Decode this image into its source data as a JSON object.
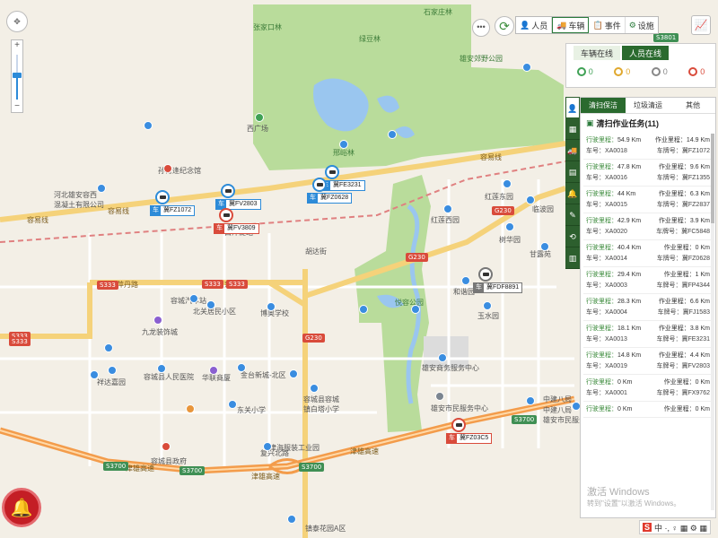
{
  "map": {
    "labels": [
      {
        "text": "张家口林",
        "cls": "green"
      },
      {
        "text": "石家庄林",
        "cls": "green"
      },
      {
        "text": "绿豆林",
        "cls": "green"
      },
      {
        "text": "雄安郊野公园",
        "cls": "green"
      },
      {
        "text": "西广场",
        "cls": ""
      },
      {
        "text": "邢峪林",
        "cls": "green"
      },
      {
        "text": "孙奇逢纪念馆",
        "cls": ""
      },
      {
        "text": "河北雄安容西\n混凝土有限公司",
        "cls": ""
      },
      {
        "text": "白洋淀站",
        "cls": ""
      },
      {
        "text": "红莲东园",
        "cls": ""
      },
      {
        "text": "红莲西园",
        "cls": ""
      },
      {
        "text": "临波园",
        "cls": ""
      },
      {
        "text": "树华园",
        "cls": ""
      },
      {
        "text": "甘露苑",
        "cls": ""
      },
      {
        "text": "和谐园",
        "cls": ""
      },
      {
        "text": "玉水园",
        "cls": ""
      },
      {
        "text": "容城汽车站",
        "cls": ""
      },
      {
        "text": "北关居民小区",
        "cls": ""
      },
      {
        "text": "博奥学校",
        "cls": ""
      },
      {
        "text": "九龙装饰城",
        "cls": ""
      },
      {
        "text": "容城县人民医院",
        "cls": ""
      },
      {
        "text": "华联商厦",
        "cls": ""
      },
      {
        "text": "金台新城-北区",
        "cls": ""
      },
      {
        "text": "祥达嘉园",
        "cls": ""
      },
      {
        "text": "东关小学",
        "cls": ""
      },
      {
        "text": "容城县容城\n镇白塔小学",
        "cls": ""
      },
      {
        "text": "雄安商务服务中心",
        "cls": ""
      },
      {
        "text": "雄安市民服务中心",
        "cls": ""
      },
      {
        "text": "津海服装工业园",
        "cls": ""
      },
      {
        "text": "容城县政府",
        "cls": ""
      },
      {
        "text": "镇泰花园A区",
        "cls": ""
      },
      {
        "text": "中建八局",
        "cls": ""
      },
      {
        "text": "中建八局\n雄安市民服务中心",
        "cls": ""
      },
      {
        "text": "悦容公园",
        "cls": "green"
      },
      {
        "text": "胡达街",
        "cls": ""
      },
      {
        "text": "复兴北路",
        "cls": ""
      }
    ],
    "roads": [
      "容易线",
      "容易线",
      "容易线",
      "萍丹路",
      "萍丹路",
      "津雄高速",
      "津雄高速",
      "津雄高速"
    ],
    "shields": [
      "G230",
      "G230",
      "G230",
      "S333",
      "S333",
      "S333",
      "S333",
      "S333",
      "S3700",
      "S3700",
      "S3700",
      "S3700",
      "S3801"
    ],
    "vehicles": [
      {
        "plate": "冀FZ1072",
        "pin": "blue",
        "tag": "blue"
      },
      {
        "plate": "冀FV2803",
        "pin": "blue",
        "tag": "blue"
      },
      {
        "plate": "冀FV3809",
        "pin": "redp",
        "tag": "red"
      },
      {
        "plate": "冀FE3231",
        "pin": "blue",
        "tag": "blue"
      },
      {
        "plate": "冀FZ0628",
        "pin": "blue",
        "tag": "blue"
      },
      {
        "plate": "冀FDF8891",
        "pin": "gray",
        "tag": "gray"
      },
      {
        "plate": "冀FZ03C5",
        "pin": "redp",
        "tag": "red"
      }
    ],
    "car_prefix": "车"
  },
  "controls": {
    "compass_icon": "compass-icon",
    "zoom_in": "+",
    "zoom_out": "−",
    "more": "•••",
    "refresh": "⟳",
    "alarm": "🔔",
    "stats": "📈"
  },
  "toolbar": {
    "items": [
      {
        "icon": "👤",
        "label": "人员",
        "active": false
      },
      {
        "icon": "🚚",
        "label": "车辆",
        "active": true
      },
      {
        "icon": "📋",
        "label": "事件",
        "active": false
      },
      {
        "icon": "⚙",
        "label": "设施",
        "active": false
      }
    ]
  },
  "online": {
    "tabs": [
      {
        "label": "车辆在线",
        "active": false
      },
      {
        "label": "人员在线",
        "active": true
      }
    ],
    "counts": [
      {
        "cls": "green",
        "value": "0"
      },
      {
        "cls": "yellow",
        "value": "0"
      },
      {
        "cls": "gray",
        "value": "0"
      },
      {
        "cls": "red",
        "value": "0"
      }
    ]
  },
  "side_icons": [
    "👤",
    "▦",
    "🚚",
    "▤",
    "🔔",
    "✎",
    "⟲",
    "▥"
  ],
  "tasks": {
    "tabs": [
      {
        "label": "清扫保洁",
        "active": true
      },
      {
        "label": "垃圾清运",
        "active": false
      },
      {
        "label": "其他",
        "active": false
      }
    ],
    "title": "清扫作业任务(11)",
    "labels": {
      "drive": "行驶里程：",
      "work": "作业里程：",
      "car": "车号：",
      "plate": "车牌号："
    },
    "items": [
      {
        "drive": "54.9 Km",
        "work": "14.9 Km",
        "car": "XA0018",
        "plate": "冀FZ1072"
      },
      {
        "drive": "47.8 Km",
        "work": "9.6 Km",
        "car": "XA0016",
        "plate": "冀FZ1355"
      },
      {
        "drive": "44 Km",
        "work": "6.3 Km",
        "car": "XA0015",
        "plate": "冀FZ2837"
      },
      {
        "drive": "42.9 Km",
        "work": "3.9 Km",
        "car": "XA0020",
        "plate": "冀FC5848"
      },
      {
        "drive": "40.4 Km",
        "work": "0 Km",
        "car": "XA0014",
        "plate": "冀FZ0628"
      },
      {
        "drive": "29.4 Km",
        "work": "1 Km",
        "car": "XA0003",
        "plate": "冀FP4344"
      },
      {
        "drive": "28.3 Km",
        "work": "6.6 Km",
        "car": "XA0004",
        "plate": "冀FJ1583"
      },
      {
        "drive": "18.1 Km",
        "work": "3.8 Km",
        "car": "XA0013",
        "plate": "冀FE3231"
      },
      {
        "drive": "14.8 Km",
        "work": "4.4 Km",
        "car": "XA0019",
        "plate": "冀FV2803"
      },
      {
        "drive": "0 Km",
        "work": "0 Km",
        "car": "XA0001",
        "plate": "冀FX9762"
      },
      {
        "drive": "0 Km",
        "work": "0 Km",
        "car": "",
        "plate": ""
      }
    ]
  },
  "watermark": {
    "title": "激活 Windows",
    "sub": "转到\"设置\"以激活 Windows。"
  },
  "ime": {
    "s": "S",
    "text": "中 ·, ♀ ▦ ⚙ ▦"
  }
}
